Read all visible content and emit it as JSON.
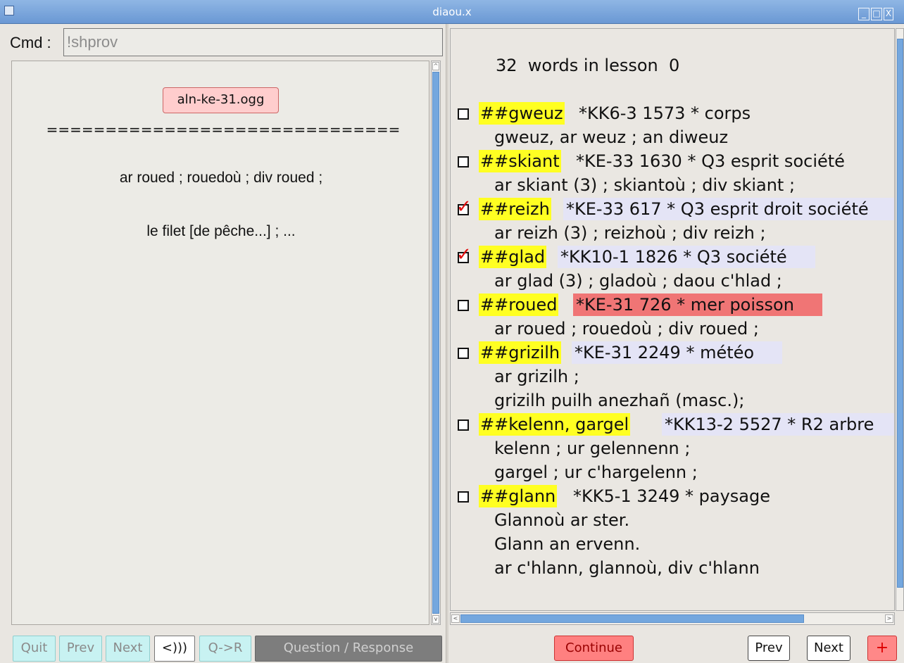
{
  "window": {
    "title": "diaou.x"
  },
  "cmd": {
    "label": "Cmd :",
    "value": "!shprov"
  },
  "question": {
    "audio_file": "aln-ke-31.ogg",
    "separator": "==============================",
    "text_line1": "ar roued ; rouedoù ; div roued ;",
    "text_line2": "le filet [de pêche...] ; ..."
  },
  "left_buttons": {
    "quit": "Quit",
    "prev": "Prev",
    "next": "Next",
    "play": "<)))",
    "q_to_r": "Q->R",
    "mode": "Question / Response"
  },
  "lesson": {
    "header": "32  words in lesson  0",
    "entries": [
      {
        "keyword": "##gweuz",
        "meta": "*KK6-3 1573 * corps",
        "checked": false,
        "highlight": "none",
        "lines": [
          "gweuz, ar weuz ;  an diweuz"
        ]
      },
      {
        "keyword": "##skiant",
        "meta": "*KE-33 1630 * Q3 esprit société",
        "checked": false,
        "highlight": "none",
        "lines": [
          "ar skiant (3) ; skiantoù ; div skiant ;"
        ]
      },
      {
        "keyword": "##reizh",
        "meta": "*KE-33 617 * Q3 esprit droit société",
        "checked": true,
        "highlight": "lavender",
        "lines": [
          "ar reizh (3) ; reizhoù ; div reizh ;"
        ]
      },
      {
        "keyword": "##glad",
        "meta": "*KK10-1 1826 * Q3 société",
        "checked": true,
        "highlight": "lavender",
        "lines": [
          "ar glad (3) ; gladoù ; daou c'hlad ;"
        ]
      },
      {
        "keyword": "##roued",
        "meta": "*KE-31 726 * mer poisson",
        "checked": false,
        "highlight": "red",
        "lines": [
          "ar roued ; rouedoù ; div roued ;"
        ]
      },
      {
        "keyword": "##grizilh",
        "meta": "*KE-31 2249 * météo",
        "checked": false,
        "highlight": "lavender",
        "lines": [
          "ar grizilh ;",
          "grizilh puilh anezhañ (masc.);"
        ]
      },
      {
        "keyword": "##kelenn, gargel",
        "meta": "*KK13-2 5527 * R2 arbre",
        "checked": false,
        "highlight": "lavender",
        "lines": [
          "kelenn ; ur gelennenn ;",
          "gargel ; ur c'hargelenn ;"
        ]
      },
      {
        "keyword": "##glann",
        "meta": "*KK5-1 3249 * paysage",
        "checked": false,
        "highlight": "none",
        "lines": [
          "Glannoù ar ster.",
          "Glann an ervenn.",
          "ar c'hlann, glannoù, div c'hlann"
        ]
      }
    ]
  },
  "right_buttons": {
    "continue": "Continue",
    "prev": "Prev",
    "next": "Next",
    "plus": "+"
  }
}
